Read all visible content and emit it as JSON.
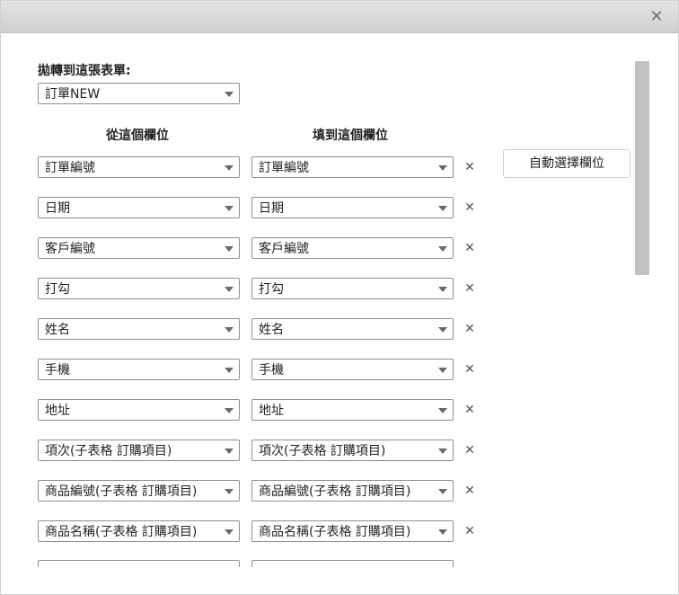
{
  "dialog": {
    "close_symbol": "✕"
  },
  "target": {
    "label": "拋轉到這張表單:",
    "selected": "訂單NEW"
  },
  "columns": {
    "from": "從這個欄位",
    "to": "填到這個欄位"
  },
  "auto_button": "自動選擇欄位",
  "remove_symbol": "✕",
  "mappings": [
    {
      "from": "訂單編號",
      "to": "訂單編號"
    },
    {
      "from": "日期",
      "to": "日期"
    },
    {
      "from": "客戶編號",
      "to": "客戶編號"
    },
    {
      "from": "打勾",
      "to": "打勾"
    },
    {
      "from": "姓名",
      "to": "姓名"
    },
    {
      "from": "手機",
      "to": "手機"
    },
    {
      "from": "地址",
      "to": "地址"
    },
    {
      "from": "項次(子表格 訂購項目)",
      "to": "項次(子表格 訂購項目)"
    },
    {
      "from": "商品編號(子表格 訂購項目)",
      "to": "商品編號(子表格 訂購項目)"
    },
    {
      "from": "商品名稱(子表格 訂購項目)",
      "to": "商品名稱(子表格 訂購項目)"
    }
  ]
}
